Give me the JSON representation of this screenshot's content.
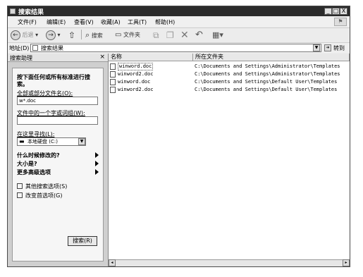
{
  "window": {
    "title": "搜索结果",
    "min_label": "_",
    "max_label": "□",
    "close_label": "X"
  },
  "menu": {
    "items": [
      "文件(F)",
      "编辑(E)",
      "查看(V)",
      "收藏(A)",
      "工具(T)",
      "帮助(H)"
    ]
  },
  "toolbar": {
    "back_label": "后退",
    "search_label": "搜索",
    "folders_label": "文件夹"
  },
  "address": {
    "label": "地址(D)",
    "value": "搜索结果",
    "go_label": "转到"
  },
  "search_pane": {
    "header": "搜索助理",
    "close_label": "×",
    "heading": "按下面任何或所有标准进行搜索。",
    "name_label": "全部或部分文件名(O):",
    "name_value": "w*.doc",
    "phrase_label": "文件中的一个字或词组(W):",
    "phrase_value": "",
    "lookin_label": "在这里寻找(L):",
    "lookin_value": "本地硬盘 (C:)",
    "when_modified": "什么时候修改的?",
    "size": "大小是?",
    "more_options": "更多高级选项",
    "other_options": "其他搜索选项(S)",
    "change_prefs": "改变首选项(G)",
    "search_button": "搜索(R)"
  },
  "results": {
    "columns": [
      "名称",
      "所在文件夹"
    ],
    "rows": [
      {
        "name": "winword.doc",
        "folder": "C:\\Documents and Settings\\Administrator\\Templates"
      },
      {
        "name": "winword2.doc",
        "folder": "C:\\Documents and Settings\\Administrator\\Templates"
      },
      {
        "name": "winword.doc",
        "folder": "C:\\Documents and Settings\\Default User\\Templates"
      },
      {
        "name": "winword2.doc",
        "folder": "C:\\Documents and Settings\\Default User\\Templates"
      }
    ]
  }
}
